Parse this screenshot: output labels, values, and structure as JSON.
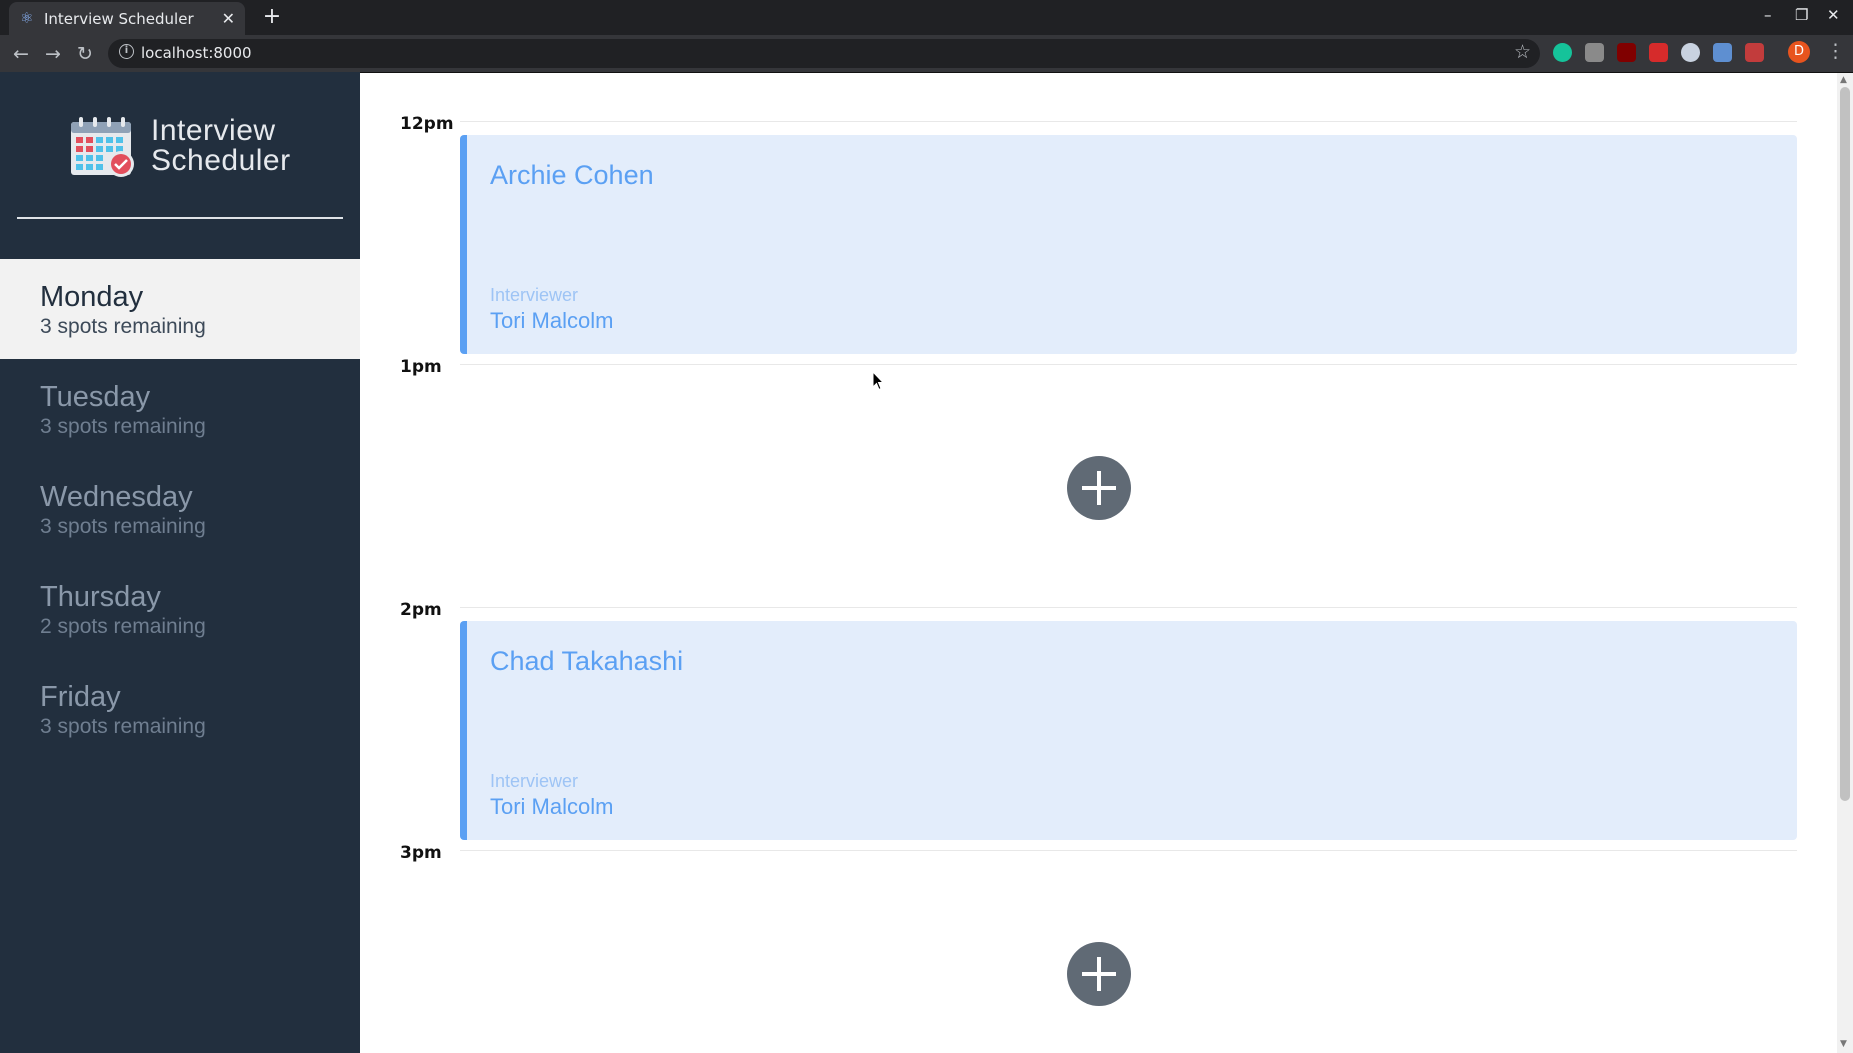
{
  "browser": {
    "tab_title": "Interview Scheduler",
    "url": "localhost:8000",
    "profile_initial": "D",
    "icons": [
      "react-icon",
      "close-icon",
      "new-tab-icon",
      "back-icon",
      "forward-icon",
      "reload-icon",
      "info-icon",
      "star-icon",
      "menu-icon"
    ]
  },
  "sidebar": {
    "logo_line1": "Interview",
    "logo_line2": "Scheduler",
    "days": [
      {
        "name": "Monday",
        "spots": "3 spots remaining",
        "selected": true
      },
      {
        "name": "Tuesday",
        "spots": "3 spots remaining",
        "selected": false
      },
      {
        "name": "Wednesday",
        "spots": "3 spots remaining",
        "selected": false
      },
      {
        "name": "Thursday",
        "spots": "2 spots remaining",
        "selected": false
      },
      {
        "name": "Friday",
        "spots": "3 spots remaining",
        "selected": false
      }
    ]
  },
  "schedule": {
    "slots": [
      {
        "time": "12pm",
        "student": "Archie Cohen",
        "interviewer_label": "Interviewer",
        "interviewer": "Tori Malcolm"
      },
      {
        "time": "1pm"
      },
      {
        "time": "2pm",
        "student": "Chad Takahashi",
        "interviewer_label": "Interviewer",
        "interviewer": "Tori Malcolm"
      },
      {
        "time": "3pm"
      }
    ]
  },
  "colors": {
    "sidebar_bg": "#222f3e",
    "card_bg": "#e3edfb",
    "accent": "#5ba0f3",
    "add_button": "#606a75"
  }
}
